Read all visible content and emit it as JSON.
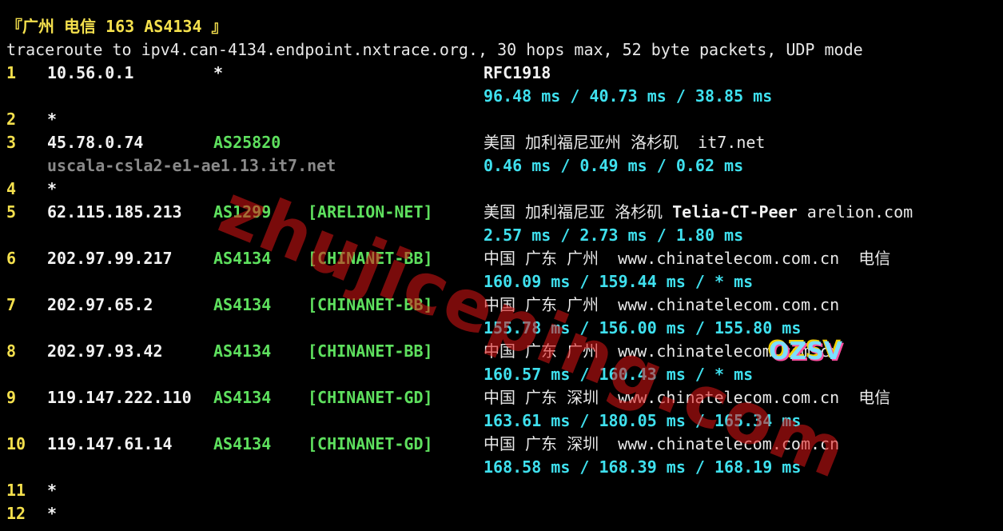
{
  "header": {
    "title": "『广州 电信 163 AS4134 』",
    "command": "traceroute to ipv4.can-4134.endpoint.nxtrace.org., 30 hops max, 52 byte packets, UDP mode"
  },
  "hops": [
    {
      "num": "1",
      "ip": "10.56.0.1",
      "asn": "*",
      "tag": "",
      "geo": "RFC1918",
      "geo_bold": "",
      "geo_extra": "",
      "host": "",
      "rtt": "96.48 ms / 40.73 ms / 38.85 ms"
    },
    {
      "num": "2",
      "ip": "*"
    },
    {
      "num": "3",
      "ip": "45.78.0.74",
      "asn": "AS25820",
      "tag": "",
      "geo": "美国 加利福尼亚州 洛杉矶  it7.net",
      "geo_bold": "",
      "geo_extra": "",
      "host": "uscala-csla2-e1-ae1.13.it7.net",
      "rtt": "0.46 ms / 0.49 ms / 0.62 ms"
    },
    {
      "num": "4",
      "ip": "*"
    },
    {
      "num": "5",
      "ip": "62.115.185.213",
      "asn": "AS1299",
      "tag": "[ARELION-NET]",
      "geo": "美国 加利福尼亚 洛杉矶 ",
      "geo_bold": "Telia-CT-Peer",
      "geo_extra": " arelion.com",
      "host": "",
      "rtt": "2.57 ms / 2.73 ms / 1.80 ms"
    },
    {
      "num": "6",
      "ip": "202.97.99.217",
      "asn": "AS4134",
      "tag": "[CHINANET-BB]",
      "geo": "中国 广东 广州  www.chinatelecom.com.cn  电信",
      "geo_bold": "",
      "geo_extra": "",
      "host": "",
      "rtt": "160.09 ms / 159.44 ms / * ms"
    },
    {
      "num": "7",
      "ip": "202.97.65.2",
      "asn": "AS4134",
      "tag": "[CHINANET-BB]",
      "geo": "中国 广东 广州  www.chinatelecom.com.cn",
      "geo_bold": "",
      "geo_extra": "",
      "host": "",
      "rtt": "155.78 ms / 156.00 ms / 155.80 ms"
    },
    {
      "num": "8",
      "ip": "202.97.93.42",
      "asn": "AS4134",
      "tag": "[CHINANET-BB]",
      "geo": "中国 广东 广州  www.chinatelecom.com.cn",
      "geo_bold": "",
      "geo_extra": "",
      "host": "",
      "rtt": "160.57 ms / 160.43 ms / * ms"
    },
    {
      "num": "9",
      "ip": "119.147.222.110",
      "asn": "AS4134",
      "tag": "[CHINANET-GD]",
      "geo": "中国 广东 深圳  www.chinatelecom.com.cn  电信",
      "geo_bold": "",
      "geo_extra": "",
      "host": "",
      "rtt": "163.61 ms / 180.05 ms / 165.34 ms"
    },
    {
      "num": "10",
      "ip": "119.147.61.14",
      "asn": "AS4134",
      "tag": "[CHINANET-GD]",
      "geo": "中国 广东 深圳  www.chinatelecom.com.cn",
      "geo_bold": "",
      "geo_extra": "",
      "host": "",
      "rtt": "168.58 ms / 168.39 ms / 168.19 ms"
    },
    {
      "num": "11",
      "ip": "*"
    },
    {
      "num": "12",
      "ip": "*"
    }
  ],
  "watermark": {
    "text": "zhujiceping.com",
    "badge": "OZSV"
  },
  "colors": {
    "background": "#000000",
    "hop_number": "#f4e04d",
    "asn": "#5ee05e",
    "rtt": "#3fe0ee",
    "hostname": "#8a8a8a"
  }
}
